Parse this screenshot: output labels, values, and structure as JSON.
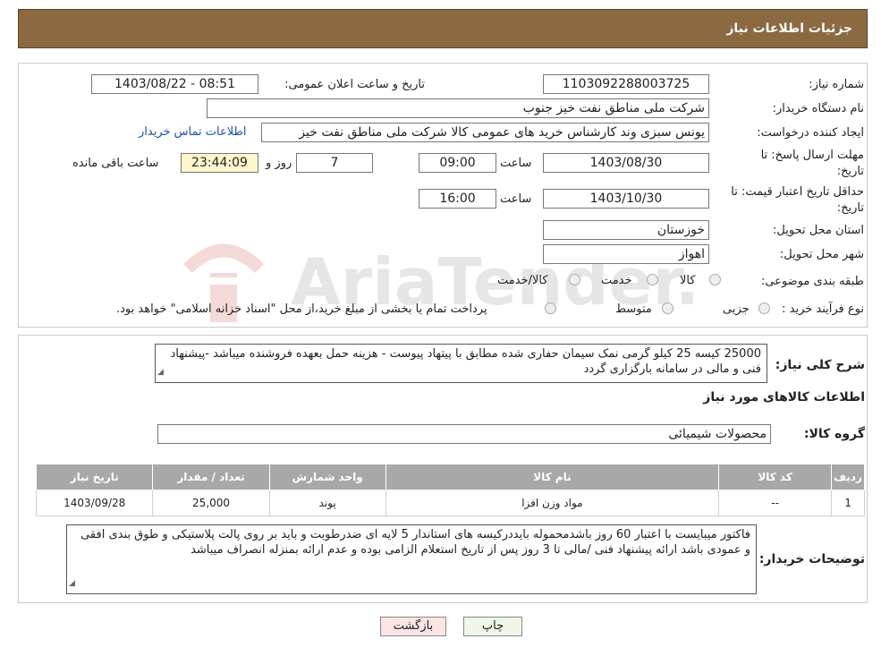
{
  "header": {
    "title": "جزئیات اطلاعات نیاز"
  },
  "form": {
    "need_number_label": "شماره نیاز:",
    "need_number": "1103092288003725",
    "announce_label": "تاریخ و ساعت اعلان عمومی:",
    "announce_value": "1403/08/22 - 08:51",
    "buyer_org_label": "نام دستگاه خریدار:",
    "buyer_org": "شرکت ملی مناطق نفت خیز جنوب",
    "creator_label": "ایجاد کننده درخواست:",
    "creator": "یونس سبزی وند کارشناس خرید های عمومی کالا شرکت ملی مناطق نفت خیز",
    "contact_link": "اطلاعات تماس خریدار",
    "deadline_label_1": "مهلت ارسال پاسخ: تا",
    "deadline_label_2": "تاریخ:",
    "deadline_date": "1403/08/30",
    "time_label": "ساعت",
    "deadline_time": "09:00",
    "days_value": "7",
    "days_label": "روز و",
    "remaining_time": "23:44:09",
    "remaining_label": "ساعت باقی مانده",
    "validity_label_1": "حداقل تاریخ اعتبار قیمت: تا",
    "validity_label_2": "تاریخ:",
    "validity_date": "1403/10/30",
    "validity_time": "16:00",
    "province_label": "استان محل تحویل:",
    "province": "خوزستان",
    "city_label": "شهر محل تحویل:",
    "city": "اهواز",
    "category_label": "طبقه بندی موضوعی:",
    "category_options": [
      "کالا",
      "خدمت",
      "کالا/خدمت"
    ],
    "process_label": "نوع فرآیند خرید :",
    "process_options": [
      "جزیی",
      "متوسط"
    ],
    "process_note": "پرداخت تمام یا بخشی از مبلغ خرید،از محل \"اسناد خزانه اسلامی\" خواهد بود."
  },
  "summary": {
    "label": "شرح کلی نیاز:",
    "text": "25000 کیسه  25 کیلو گرمی نمک سیمان حفاری شده مطابق با پیتهاد پیوست - هزینه حمل بعهده فروشنده میباشد -پیشنهاد فنی و مالی در سامانه بارگزاری گردد"
  },
  "goods": {
    "section_title": "اطلاعات کالاهای مورد نیاز",
    "group_label": "گروه کالا:",
    "group_value": "محصولات شیمیائی",
    "columns": [
      "ردیف",
      "کد کالا",
      "نام کالا",
      "واحد شمارش",
      "تعداد / مقدار",
      "تاریخ نیاز"
    ],
    "rows": [
      [
        "1",
        "--",
        "مواد وزن افزا",
        "پوند",
        "25,000",
        "1403/09/28"
      ]
    ]
  },
  "buyer_notes": {
    "label": "توضیحات خریدار:",
    "text": "فاکتور میبایست با اعتبار 60 روز باشدمحموله بایددرکیسه های استاندار 5 لایه ای ضدرطوبت و باید بر روی پالت پلاستیکی و طوق بندی افقی و عمودی باشد ارائه پیشنهاد فنی /مالی تا 3 روز پس از تاریخ استعلام الزامی بوده و عدم ارائه بمنزله انصراف میباشد"
  },
  "buttons": {
    "print": "چاپ",
    "back": "بازگشت"
  },
  "watermark_text": "AriaTender.neT"
}
